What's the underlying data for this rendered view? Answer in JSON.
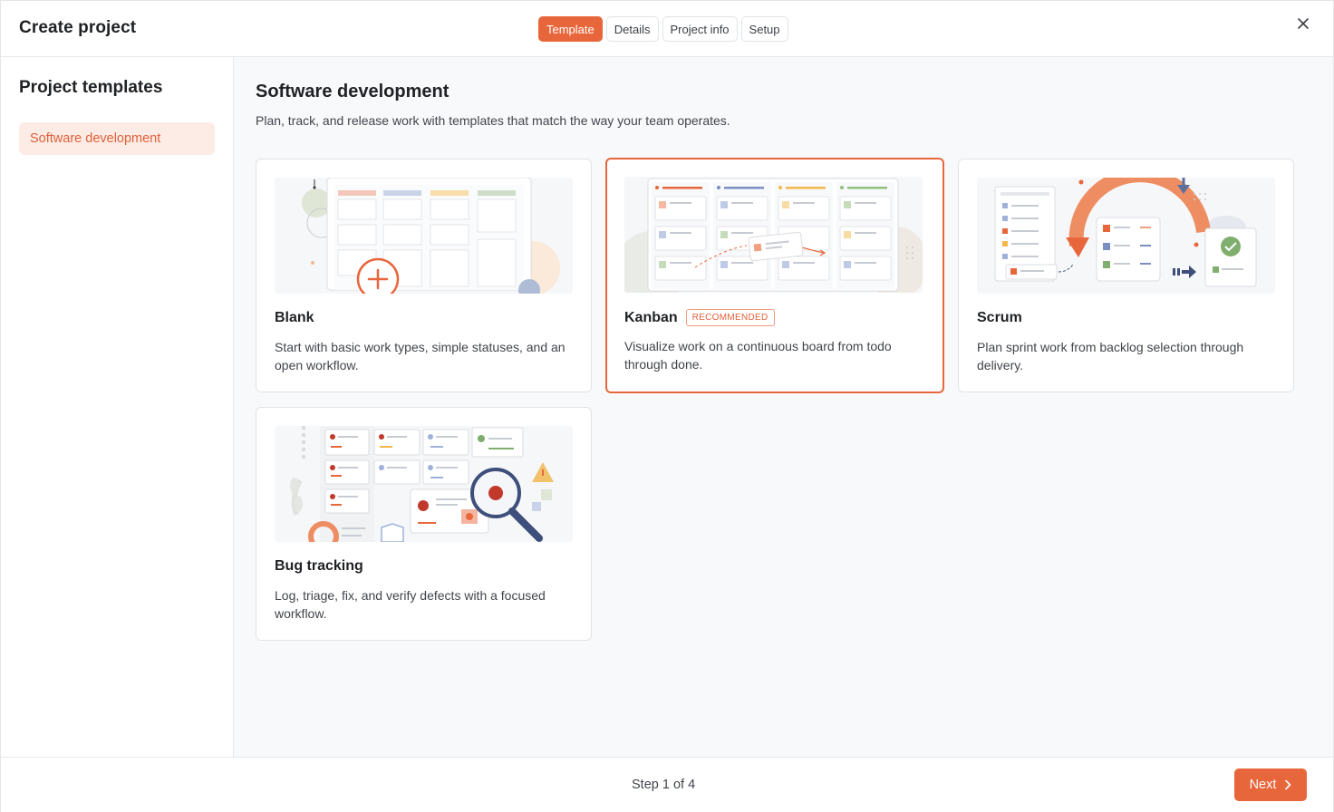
{
  "header": {
    "title": "Create project",
    "steps": [
      {
        "label": "Template",
        "active": true
      },
      {
        "label": "Details",
        "active": false
      },
      {
        "label": "Project info",
        "active": false
      },
      {
        "label": "Setup",
        "active": false
      }
    ],
    "close_icon": "close-icon"
  },
  "sidebar": {
    "title": "Project templates",
    "items": [
      {
        "label": "Software development",
        "selected": true
      }
    ]
  },
  "main": {
    "title": "Software development",
    "description": "Plan, track, and release work with templates that match the way your team operates.",
    "templates": [
      {
        "title": "Blank",
        "badge": "",
        "description": "Start with basic work types, simple statuses, and an open workflow.",
        "selected": false,
        "illustration": "blank-board-plus-illustration"
      },
      {
        "title": "Kanban",
        "badge": "RECOMMENDED",
        "description": "Visualize work on a continuous board from todo through done.",
        "selected": true,
        "illustration": "kanban-board-illustration"
      },
      {
        "title": "Scrum",
        "badge": "",
        "description": "Plan sprint work from backlog selection through delivery.",
        "selected": false,
        "illustration": "sprint-cycle-illustration"
      },
      {
        "title": "Bug tracking",
        "badge": "",
        "description": "Log, triage, fix, and verify defects with a focused workflow.",
        "selected": false,
        "illustration": "bug-magnifier-illustration"
      }
    ]
  },
  "footer": {
    "step_text": "Step 1 of 4",
    "next_label": "Next"
  },
  "colors": {
    "accent": "#e8663b",
    "accent_soft": "#fdece5",
    "blue": "#8a9fd0",
    "yellow": "#f2c26b",
    "green": "#9bbf8f"
  }
}
